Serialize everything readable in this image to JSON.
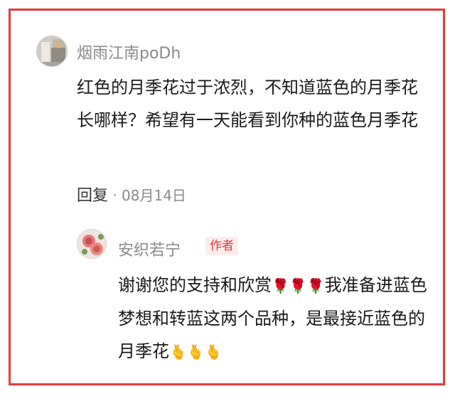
{
  "comment": {
    "author": "烟雨江南poDh",
    "text": "红色的月季花过于浓烈，不知道蓝色的月季花长哪样？希望有一天能看到你种的蓝色月季花",
    "reply_label": "回复",
    "separator": "·",
    "date": "08月14日"
  },
  "reply": {
    "author": "安织若宁",
    "badge": "作者",
    "text_part1": "谢谢您的支持和欣赏",
    "rose_emojis": "🌹🌹🌹",
    "text_part2": "我准备进蓝色梦想和转蓝这两个品种，是最接近蓝色的月季花",
    "hand_emojis": "🫰🫰🫰"
  },
  "colors": {
    "border": "#e8383d",
    "badge_text": "#e8383d",
    "badge_bg": "#fdecec",
    "name_gray": "#8a8a8a"
  }
}
